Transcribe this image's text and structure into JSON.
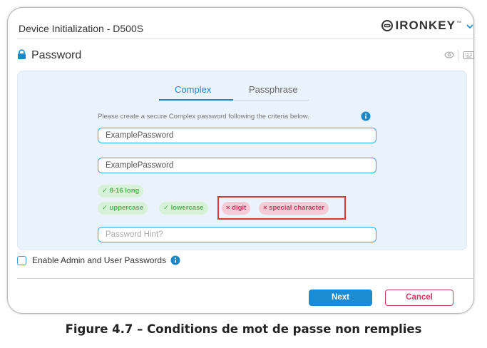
{
  "window": {
    "title": "Device Initialization - D500S",
    "brand": "IRONKEY",
    "brand_tm": "™"
  },
  "section": {
    "title": "Password"
  },
  "tabs": [
    {
      "label": "Complex"
    },
    {
      "label": "Passphrase"
    }
  ],
  "form": {
    "instruction": "Please create a secure Complex password following the criteria below.",
    "password_value": "ExamplePassword",
    "confirm_value": "ExamplePassword",
    "hint_placeholder": "Password Hint?"
  },
  "criteria": [
    {
      "label": "✓ 8-16 long",
      "met": true
    },
    {
      "label": "✓ uppercase",
      "met": true
    },
    {
      "label": "✓ lowercase",
      "met": true
    },
    {
      "label": "× digit",
      "met": false
    },
    {
      "label": "× special character",
      "met": false
    }
  ],
  "options": {
    "admin_user_label": "Enable Admin and User Passwords"
  },
  "buttons": {
    "next": "Next",
    "cancel": "Cancel"
  },
  "caption": "Figure 4.7 – Conditions de mot de passe non remplies",
  "colors": {
    "accent": "#1b87c9",
    "ok": "#52b157",
    "bad": "#c9385e",
    "highlight": "#d43a3a"
  }
}
